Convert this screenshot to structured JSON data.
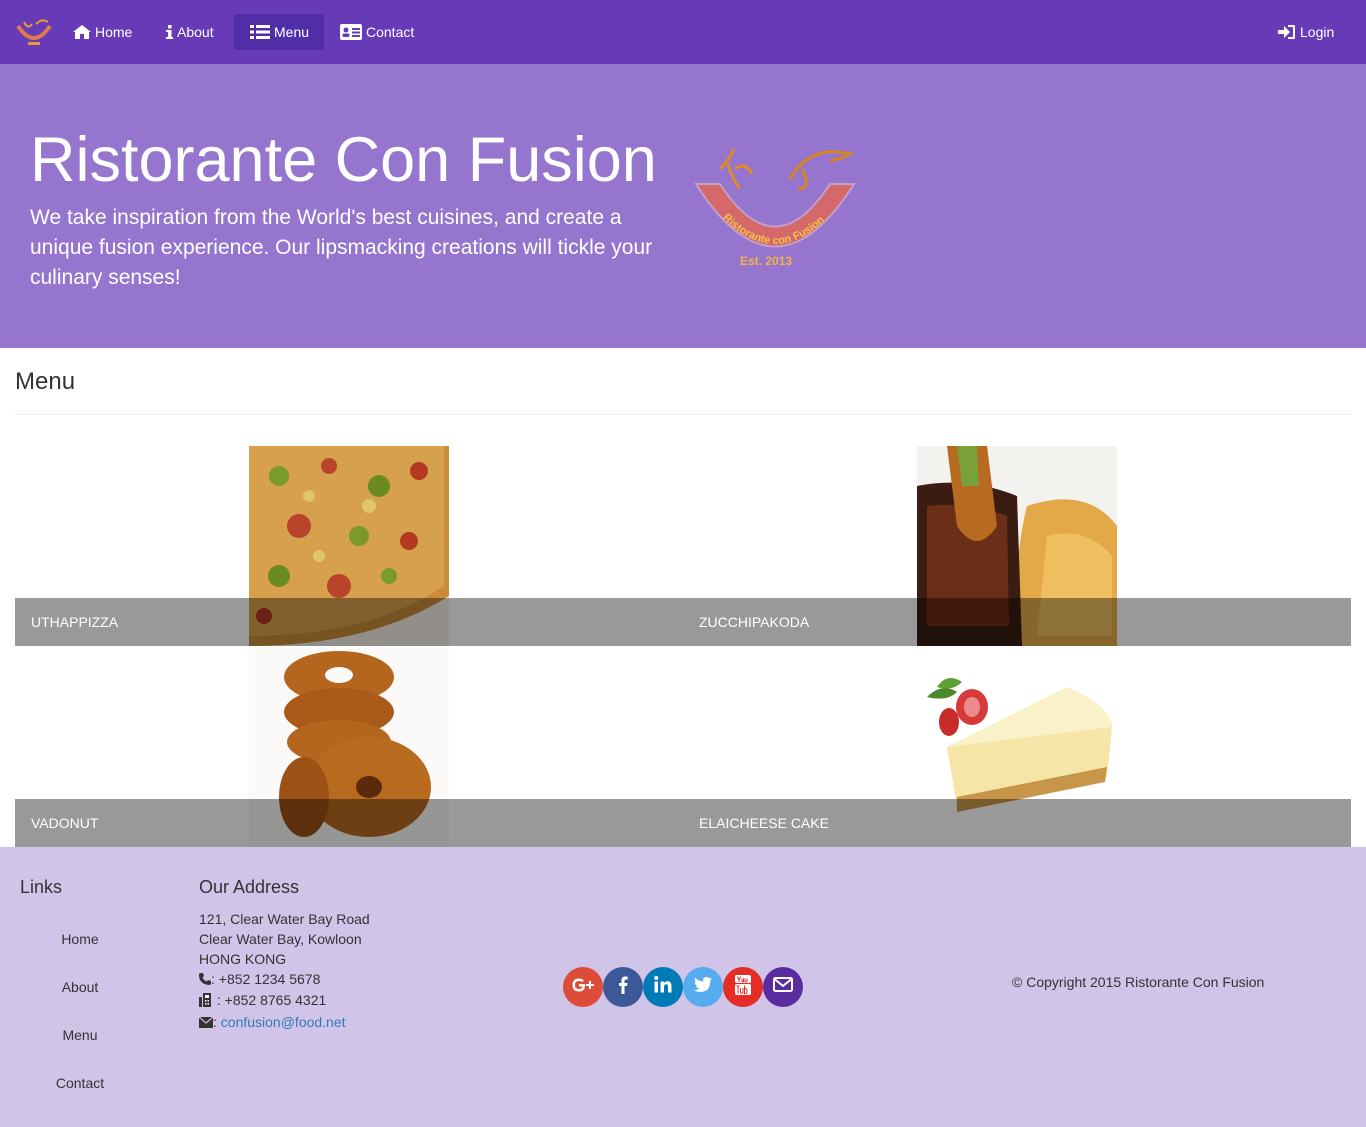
{
  "nav": {
    "home_label": "Home",
    "about_label": "About",
    "menu_label": "Menu",
    "contact_label": "Contact",
    "login_label": "Login",
    "active": "Menu"
  },
  "jumbotron": {
    "title": "Ristorante Con Fusion",
    "description": "We take inspiration from the World's best cuisines, and create a unique fusion experience. Our lipsmacking creations will tickle your culinary senses!",
    "logo_text": "Ristorante con Fusion",
    "logo_est": "Est. 2013"
  },
  "menu": {
    "heading": "Menu",
    "dishes": [
      {
        "name": "UTHAPPIZZA",
        "image": "pizza"
      },
      {
        "name": "ZUCCHIPAKODA",
        "image": "pakoda-with-sauce"
      },
      {
        "name": "VADONUT",
        "image": "fried-donuts"
      },
      {
        "name": "ELAICHEESE CAKE",
        "image": "cheesecake-with-strawberry"
      }
    ]
  },
  "footer": {
    "links_heading": "Links",
    "links": [
      "Home",
      "About",
      "Menu",
      "Contact"
    ],
    "address_heading": "Our Address",
    "address_line1": "121, Clear Water Bay Road",
    "address_line2": "Clear Water Bay, Kowloon",
    "address_line3": "HONG KONG",
    "phone": ": +852 1234 5678",
    "fax": ": +852 8765 4321",
    "email_sep": ":",
    "email": "confusion@food.net",
    "social": [
      {
        "name": "google-plus",
        "color": "#dd4b39"
      },
      {
        "name": "facebook",
        "color": "#3b5998"
      },
      {
        "name": "linkedin",
        "color": "#007bb6"
      },
      {
        "name": "twitter",
        "color": "#55acee"
      },
      {
        "name": "youtube",
        "color": "#e52d27"
      },
      {
        "name": "email",
        "color": "#5a2ca0"
      }
    ],
    "copyright": "© Copyright 2015 Ristorante Con Fusion"
  },
  "colors": {
    "primary": "#673AB7",
    "primary_dark": "#512DA8",
    "jumbotron_bg": "#9575CD",
    "footer_bg": "#D1C4E9",
    "link": "#337ab7"
  }
}
